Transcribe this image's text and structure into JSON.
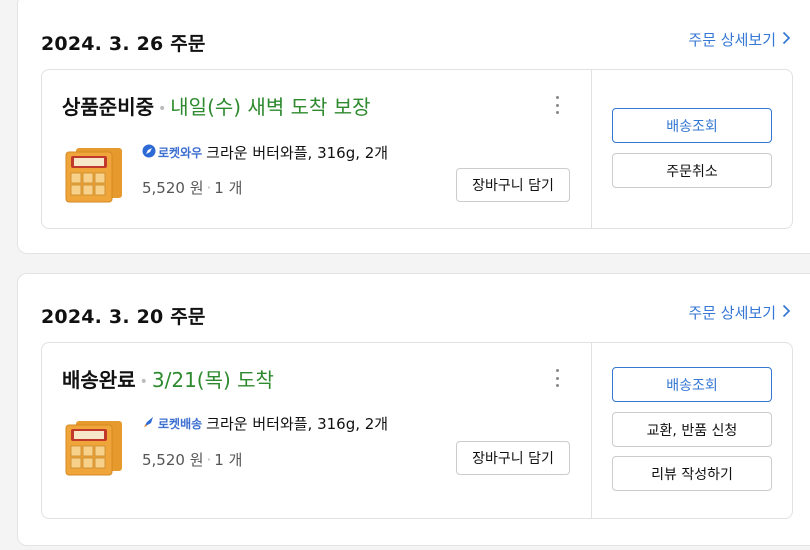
{
  "colors": {
    "accent": "#3477d4",
    "green": "#2e8a2e",
    "border": "#e1e1e1"
  },
  "orders": [
    {
      "date": "2024. 3. 26 주문",
      "detail_link": "주문 상세보기",
      "status": "상품준비중",
      "status_note": "내일(수) 새벽 도착 보장",
      "badge": {
        "icon": "rocket-icon",
        "text": "로켓와우"
      },
      "product_name": "크라운 버터와플, 316g, 2개",
      "price": "5,520 원",
      "qty": "1 개",
      "cart_button": "장바구니 담기",
      "actions": [
        "배송조회",
        "주문취소"
      ]
    },
    {
      "date": "2024. 3. 20 주문",
      "detail_link": "주문 상세보기",
      "status": "배송완료",
      "status_note": "3/21(목) 도착",
      "badge": {
        "icon": "rocket-icon",
        "text": "로켓배송"
      },
      "product_name": "크라운 버터와플, 316g, 2개",
      "price": "5,520 원",
      "qty": "1 개",
      "cart_button": "장바구니 담기",
      "actions": [
        "배송조회",
        "교환, 반품 신청",
        "리뷰 작성하기"
      ]
    }
  ]
}
